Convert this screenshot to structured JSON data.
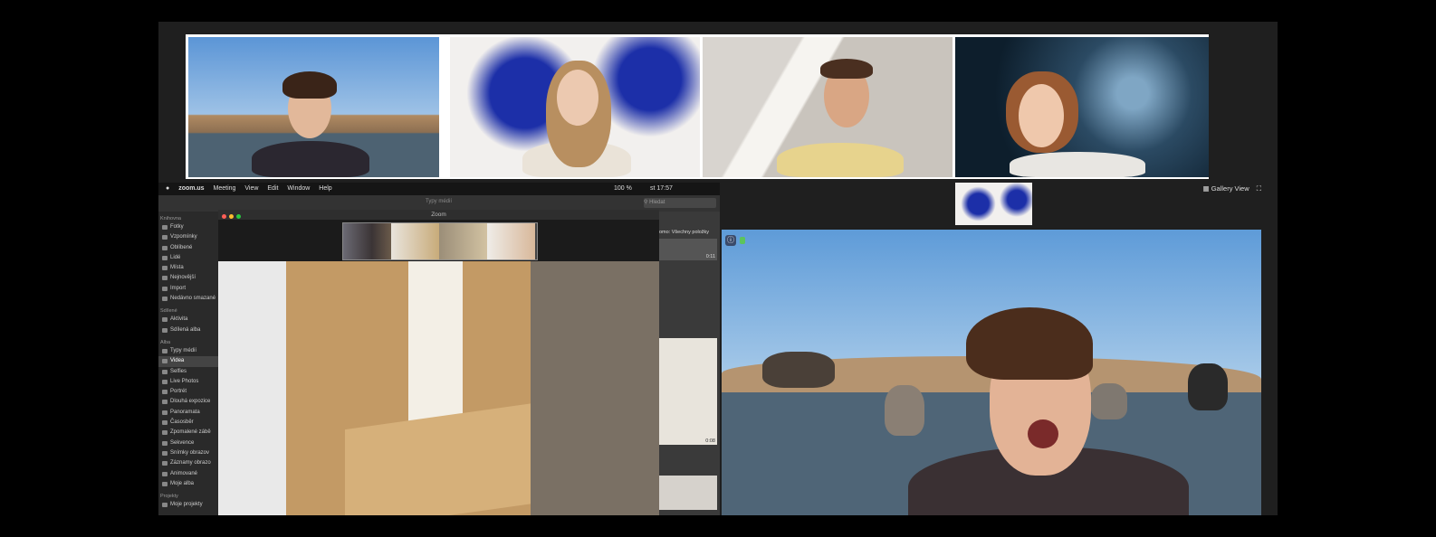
{
  "mac_menu": {
    "apple": "",
    "app": "zoom.us",
    "items": [
      "Meeting",
      "View",
      "Edit",
      "Window",
      "Help"
    ],
    "battery": "100 %",
    "clock": "st 17:57"
  },
  "photos_toolbar": {
    "search_placeholder": "Hledat",
    "types_label": "Typy médií"
  },
  "photos_sidebar": {
    "sections": [
      {
        "title": "Knihovna",
        "items": [
          "Fotky",
          "Vzpomínky",
          "Oblíbené",
          "Lidé",
          "Místa",
          "Nejnovější",
          "Import",
          "Nedávno smazané"
        ]
      },
      {
        "title": "Sdílené",
        "items": [
          "Aktivita",
          "Sdílená alba"
        ]
      },
      {
        "title": "Alba",
        "items": [
          "Typy médií",
          "Videa",
          "Selfies",
          "Live Photos",
          "Portrét",
          "Dlouhá expozice",
          "Panoramata",
          "Časosběr",
          "Zpomalené zábě",
          "Sekvence",
          "Snímky obrazov",
          "Záznamy obrazo",
          "Animované",
          "Moje alba"
        ]
      },
      {
        "title": "Projekty",
        "items": [
          "Moje projekty"
        ]
      }
    ],
    "selected": "Videa"
  },
  "zoom_window": {
    "title": "Zoom"
  },
  "photos_right": {
    "filter_label": "omo:",
    "filter_value": "Všechny položky",
    "durations": [
      "0:11",
      "0:08"
    ]
  },
  "gallery_view_label": "Gallery View",
  "colors": {
    "active_speaker_border": "#c6e36a",
    "zoom_bg": "#1f1f1f",
    "sky": "#5e9bd8"
  }
}
